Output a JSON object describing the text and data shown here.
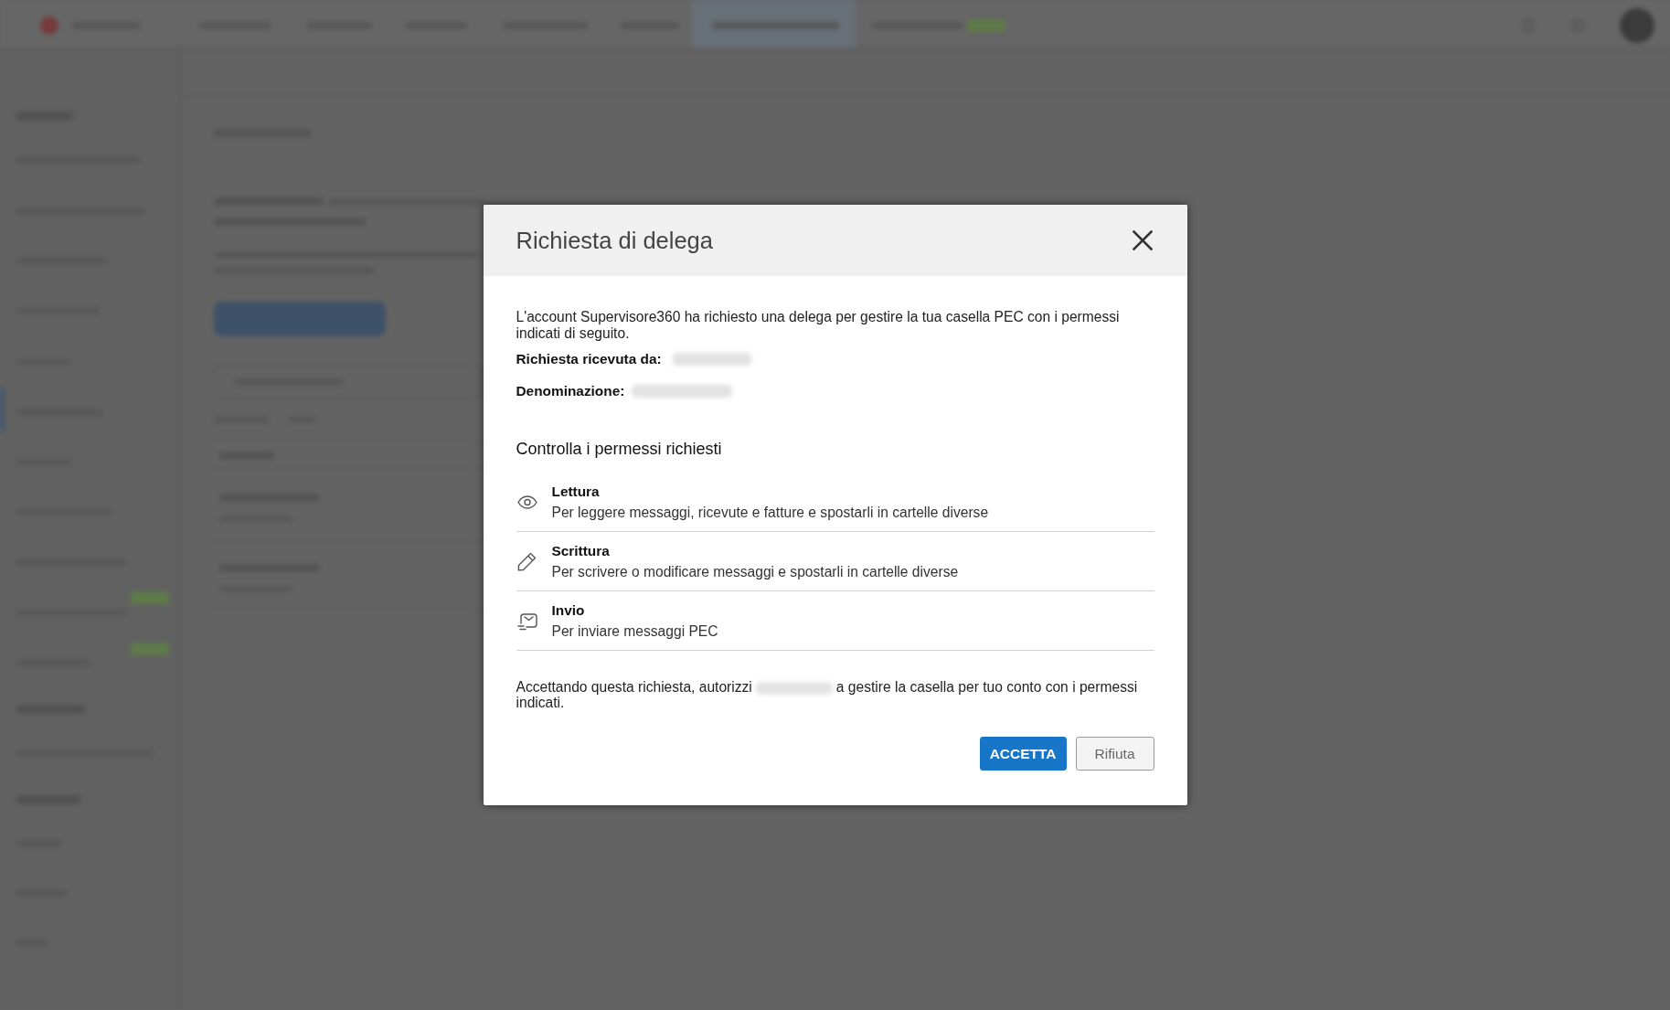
{
  "dialog": {
    "title": "Richiesta di delega",
    "intro": "L'account Supervisore360 ha richiesto una delega per gestire la tua casella PEC con i permessi indicati di seguito.",
    "fields": [
      {
        "label": "Richiesta ricevuta da:"
      },
      {
        "label": "Denominazione:"
      }
    ],
    "section_title": "Controlla i permessi richiesti",
    "permissions": [
      {
        "kind": "read",
        "title": "Lettura",
        "description": "Per leggere messaggi, ricevute e fatture e spostarli in cartelle diverse"
      },
      {
        "kind": "write",
        "title": "Scrittura",
        "description": "Per scrivere o modificare messaggi e spostarli in cartelle diverse"
      },
      {
        "kind": "send",
        "title": "Invio",
        "description": "Per inviare messaggi PEC"
      }
    ],
    "consent": {
      "before": "Accettando questa richiesta, autorizzi",
      "after": "a gestire la casella per tuo conto con i permessi indicati."
    },
    "buttons": [
      {
        "kind": "primary",
        "label": "ACCETTA"
      },
      {
        "kind": "secondary",
        "label": "Rifiuta"
      }
    ]
  }
}
